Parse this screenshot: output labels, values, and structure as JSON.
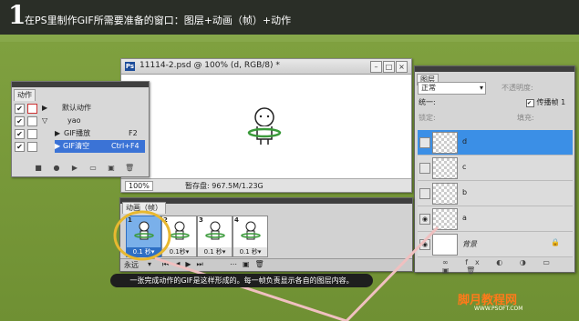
{
  "header": {
    "step_number": "1",
    "title": "在PS里制作GIF所需要准备的窗口：图层+动画（帧）+动作"
  },
  "document": {
    "title": "11114-2.psd @ 100% (d, RGB/8) *",
    "zoom": "100%",
    "status": "暂存盘: 967.5M/1.23G"
  },
  "actions_panel": {
    "tab": "动作",
    "items": [
      {
        "label": "默认动作",
        "checked": "✔",
        "shortcut": ""
      },
      {
        "label": "yao",
        "checked": "✔",
        "shortcut": ""
      },
      {
        "label": "GIF播放",
        "checked": "✔",
        "shortcut": "F2"
      },
      {
        "label": "GIF清空",
        "checked": "✔",
        "shortcut": "Ctrl+F4"
      }
    ]
  },
  "layers_panel": {
    "tab": "图层",
    "blend_mode": "正常",
    "opacity_label": "不透明度:",
    "unify_label": "统一:",
    "propagate_label": "传播帧 1",
    "lock_label": "锁定:",
    "fill_label": "填充:",
    "layers": [
      {
        "name": "d",
        "selected": true,
        "eye": ""
      },
      {
        "name": "c",
        "selected": false,
        "eye": ""
      },
      {
        "name": "b",
        "selected": false,
        "eye": ""
      },
      {
        "name": "a",
        "selected": false,
        "eye": "◉"
      },
      {
        "name": "背景",
        "selected": false,
        "eye": "◉"
      }
    ]
  },
  "animation_panel": {
    "tab": "动画（帧）",
    "loop": "永远",
    "frames": [
      {
        "num": "1",
        "delay": "0.1 秒▾"
      },
      {
        "num": "2",
        "delay": "0.1秒▾"
      },
      {
        "num": "3",
        "delay": "0.1 秒▾"
      },
      {
        "num": "4",
        "delay": "0.1 秒▾"
      }
    ]
  },
  "caption": "一张完成动作的GIF是这样形成的。每一帧负责显示各自的图层内容。",
  "logo": {
    "main": "脚月教程网",
    "sub": "WWW.PSOFT.COM"
  }
}
